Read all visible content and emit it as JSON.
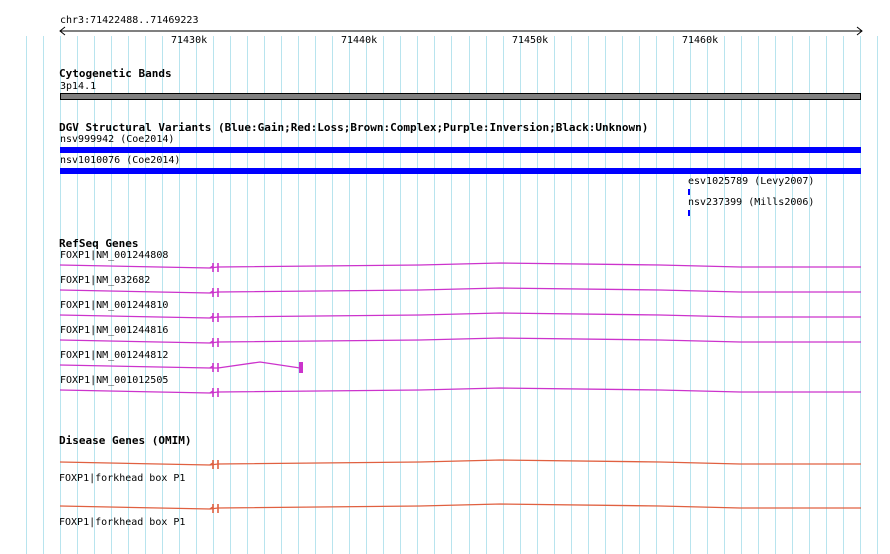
{
  "ruler": {
    "range_label": "chr3:71422488..71469223",
    "ticks": [
      "71430k",
      "71440k",
      "71450k",
      "71460k"
    ]
  },
  "cytoband": {
    "title": "Cytogenetic Bands",
    "band": "3p14.1",
    "color": "#808080"
  },
  "dgv": {
    "title": "DGV Structural Variants (Blue:Gain;Red:Loss;Brown:Complex;Purple:Inversion;Black:Unknown)",
    "color": "#0000ff",
    "variants": [
      {
        "label": "nsv999942 (Coe2014)"
      },
      {
        "label": "nsv1010076 (Coe2014)"
      },
      {
        "label": "esv1025789 (Levy2007)"
      },
      {
        "label": "nsv237399 (Mills2006)"
      }
    ]
  },
  "refseq": {
    "title": "RefSeq Genes",
    "color": "#cc33cc",
    "genes": [
      {
        "label": "FOXP1|NM_001244808"
      },
      {
        "label": "FOXP1|NM_032682"
      },
      {
        "label": "FOXP1|NM_001244810"
      },
      {
        "label": "FOXP1|NM_001244816"
      },
      {
        "label": "FOXP1|NM_001244812"
      },
      {
        "label": "FOXP1|NM_001012505"
      }
    ]
  },
  "omim": {
    "title": "Disease Genes (OMIM)",
    "color": "#e06040",
    "genes": [
      {
        "label": "FOXP1|forkhead box P1"
      },
      {
        "label": "FOXP1|forkhead box P1"
      }
    ]
  },
  "colors": {
    "grid_minor": "#b8e4ee",
    "grid_major": "#8ccfe0",
    "background": "#ffffff"
  }
}
